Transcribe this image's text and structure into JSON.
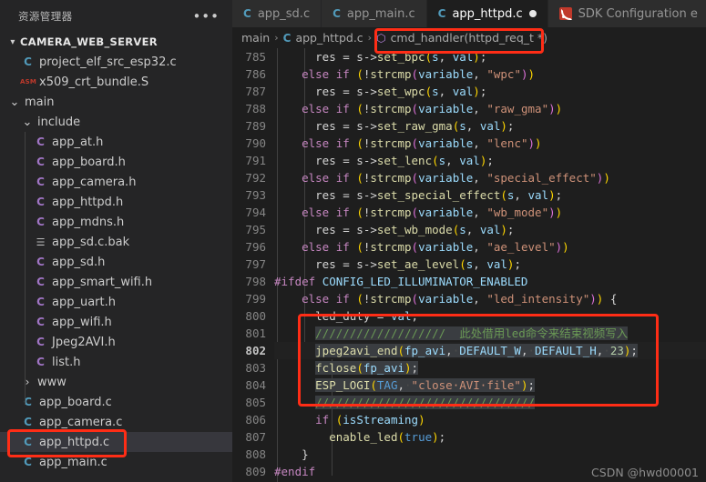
{
  "sidebar": {
    "title": "资源管理器",
    "more_label": "•••",
    "root_label": "CAMERA_WEB_SERVER",
    "items": [
      {
        "label": "project_elf_src_esp32.c",
        "icon": "c-file-icon",
        "kind": "c",
        "indent": 1,
        "type": "file"
      },
      {
        "label": "x509_crt_bundle.S",
        "icon": "asm-file-icon",
        "kind": "asm",
        "indent": 1,
        "type": "file"
      },
      {
        "label": "main",
        "icon": "chevron-down-icon",
        "kind": "folder-open",
        "indent": 0,
        "type": "folder"
      },
      {
        "label": "include",
        "icon": "chevron-down-icon",
        "kind": "folder-open",
        "indent": 1,
        "type": "folder"
      },
      {
        "label": "app_at.h",
        "icon": "h-file-icon",
        "kind": "h",
        "indent": 2,
        "type": "file"
      },
      {
        "label": "app_board.h",
        "icon": "h-file-icon",
        "kind": "h",
        "indent": 2,
        "type": "file"
      },
      {
        "label": "app_camera.h",
        "icon": "h-file-icon",
        "kind": "h",
        "indent": 2,
        "type": "file"
      },
      {
        "label": "app_httpd.h",
        "icon": "h-file-icon",
        "kind": "h",
        "indent": 2,
        "type": "file"
      },
      {
        "label": "app_mdns.h",
        "icon": "h-file-icon",
        "kind": "h",
        "indent": 2,
        "type": "file"
      },
      {
        "label": "app_sd.c.bak",
        "icon": "text-file-icon",
        "kind": "bak",
        "indent": 2,
        "type": "file"
      },
      {
        "label": "app_sd.h",
        "icon": "h-file-icon",
        "kind": "h",
        "indent": 2,
        "type": "file"
      },
      {
        "label": "app_smart_wifi.h",
        "icon": "h-file-icon",
        "kind": "h",
        "indent": 2,
        "type": "file"
      },
      {
        "label": "app_uart.h",
        "icon": "h-file-icon",
        "kind": "h",
        "indent": 2,
        "type": "file"
      },
      {
        "label": "app_wifi.h",
        "icon": "h-file-icon",
        "kind": "h",
        "indent": 2,
        "type": "file"
      },
      {
        "label": "Jpeg2AVI.h",
        "icon": "h-file-icon",
        "kind": "h",
        "indent": 2,
        "type": "file"
      },
      {
        "label": "list.h",
        "icon": "h-file-icon",
        "kind": "h",
        "indent": 2,
        "type": "file"
      },
      {
        "label": "www",
        "icon": "chevron-right-icon",
        "kind": "folder",
        "indent": 1,
        "type": "folder"
      },
      {
        "label": "app_board.c",
        "icon": "c-file-icon",
        "kind": "c",
        "indent": 1,
        "type": "file"
      },
      {
        "label": "app_camera.c",
        "icon": "c-file-icon",
        "kind": "c",
        "indent": 1,
        "type": "file"
      },
      {
        "label": "app_httpd.c",
        "icon": "c-file-icon",
        "kind": "c",
        "indent": 1,
        "type": "file",
        "selected": true,
        "highlighted": true
      },
      {
        "label": "app_main.c",
        "icon": "c-file-icon",
        "kind": "c",
        "indent": 1,
        "type": "file"
      }
    ]
  },
  "tabs": [
    {
      "label": "app_sd.c",
      "icon": "c-file-icon",
      "active": false,
      "dirty": false
    },
    {
      "label": "app_main.c",
      "icon": "c-file-icon",
      "active": false,
      "dirty": false
    },
    {
      "label": "app_httpd.c",
      "icon": "c-file-icon",
      "active": true,
      "dirty": true
    },
    {
      "label": "SDK Configuration e",
      "icon": "espressif-icon",
      "active": false,
      "dirty": false
    }
  ],
  "breadcrumb": [
    {
      "label": "main",
      "icon": ""
    },
    {
      "label": "app_httpd.c",
      "icon": "c-file-icon"
    },
    {
      "label": "cmd_handler(httpd_req_t *)",
      "icon": "symbol-method-icon",
      "highlighted": true
    }
  ],
  "editor": {
    "first_line": 785,
    "current_line": 802,
    "lines": [
      {
        "n": 785,
        "indent": 3,
        "html": "res = s-&gt;<span class=\"fn\">set_bpc</span><span class=\"pl\">(</span><span class=\"var\">s</span>, <span class=\"var\">val</span><span class=\"pl\">)</span>;"
      },
      {
        "n": 786,
        "indent": 2,
        "html": "<span class=\"k\">else if</span> <span class=\"pl\">(</span>!<span class=\"fn\">strcmp</span><span class=\"pl2\">(</span><span class=\"var\">variable</span>, <span class=\"str\">\"wpc\"</span><span class=\"pl2\">)</span><span class=\"pl\">)</span>"
      },
      {
        "n": 787,
        "indent": 3,
        "html": "res = s-&gt;<span class=\"fn\">set_wpc</span><span class=\"pl\">(</span><span class=\"var\">s</span>, <span class=\"var\">val</span><span class=\"pl\">)</span>;"
      },
      {
        "n": 788,
        "indent": 2,
        "html": "<span class=\"k\">else if</span> <span class=\"pl\">(</span>!<span class=\"fn\">strcmp</span><span class=\"pl2\">(</span><span class=\"var\">variable</span>, <span class=\"str\">\"raw_gma\"</span><span class=\"pl2\">)</span><span class=\"pl\">)</span>"
      },
      {
        "n": 789,
        "indent": 3,
        "html": "res = s-&gt;<span class=\"fn\">set_raw_gma</span><span class=\"pl\">(</span><span class=\"var\">s</span>, <span class=\"var\">val</span><span class=\"pl\">)</span>;"
      },
      {
        "n": 790,
        "indent": 2,
        "html": "<span class=\"k\">else if</span> <span class=\"pl\">(</span>!<span class=\"fn\">strcmp</span><span class=\"pl2\">(</span><span class=\"var\">variable</span>, <span class=\"str\">\"lenc\"</span><span class=\"pl2\">)</span><span class=\"pl\">)</span>"
      },
      {
        "n": 791,
        "indent": 3,
        "html": "res = s-&gt;<span class=\"fn\">set_lenc</span><span class=\"pl\">(</span><span class=\"var\">s</span>, <span class=\"var\">val</span><span class=\"pl\">)</span>;"
      },
      {
        "n": 792,
        "indent": 2,
        "html": "<span class=\"k\">else if</span> <span class=\"pl\">(</span>!<span class=\"fn\">strcmp</span><span class=\"pl2\">(</span><span class=\"var\">variable</span>, <span class=\"str\">\"special_effect\"</span><span class=\"pl2\">)</span><span class=\"pl\">)</span>"
      },
      {
        "n": 793,
        "indent": 3,
        "html": "res = s-&gt;<span class=\"fn\">set_special_effect</span><span class=\"pl\">(</span><span class=\"var\">s</span>, <span class=\"var\">val</span><span class=\"pl\">)</span>;"
      },
      {
        "n": 794,
        "indent": 2,
        "html": "<span class=\"k\">else if</span> <span class=\"pl\">(</span>!<span class=\"fn\">strcmp</span><span class=\"pl2\">(</span><span class=\"var\">variable</span>, <span class=\"str\">\"wb_mode\"</span><span class=\"pl2\">)</span><span class=\"pl\">)</span>"
      },
      {
        "n": 795,
        "indent": 3,
        "html": "res = s-&gt;<span class=\"fn\">set_wb_mode</span><span class=\"pl\">(</span><span class=\"var\">s</span>, <span class=\"var\">val</span><span class=\"pl\">)</span>;"
      },
      {
        "n": 796,
        "indent": 2,
        "html": "<span class=\"k\">else if</span> <span class=\"pl\">(</span>!<span class=\"fn\">strcmp</span><span class=\"pl2\">(</span><span class=\"var\">variable</span>, <span class=\"str\">\"ae_level\"</span><span class=\"pl2\">)</span><span class=\"pl\">)</span>"
      },
      {
        "n": 797,
        "indent": 3,
        "html": "res = s-&gt;<span class=\"fn\">set_ae_level</span><span class=\"pl\">(</span><span class=\"var\">s</span>, <span class=\"var\">val</span><span class=\"pl\">)</span>;"
      },
      {
        "n": 798,
        "indent": 0,
        "html": "<span class=\"pp\">#ifdef</span> <span class=\"var\">CONFIG_LED_ILLUMINATOR_ENABLED</span>"
      },
      {
        "n": 799,
        "indent": 2,
        "html": "<span class=\"k\">else if</span> <span class=\"pl\">(</span>!<span class=\"fn\">strcmp</span><span class=\"pl2\">(</span><span class=\"var\">variable</span>, <span class=\"str\">\"led_intensity\"</span><span class=\"pl2\">)</span><span class=\"pl\">)</span> {"
      },
      {
        "n": 800,
        "indent": 3,
        "html": "led_duty = <span class=\"var\">val</span>;"
      },
      {
        "n": 801,
        "indent": 3,
        "sel": true,
        "html": "<span class=\"cm\">///////////////////  此处借用led命令来结束视频写入</span>"
      },
      {
        "n": 802,
        "indent": 3,
        "sel": true,
        "cur": true,
        "html": "<span class=\"fn\">jpeg2avi_end</span><span class=\"pl\">(</span><span class=\"var\">fp_avi</span>,<span class=\"ws\">·</span><span class=\"var\">DEFAULT_W</span>,<span class=\"ws\">·</span><span class=\"var\">DEFAULT_H</span>,<span class=\"ws\">·</span><span class=\"num\">23</span><span class=\"pl\">)</span>;"
      },
      {
        "n": 803,
        "indent": 3,
        "sel": true,
        "html": "<span class=\"fn\">fclose</span><span class=\"pl\">(</span><span class=\"var\">fp_avi</span><span class=\"pl\">)</span>;"
      },
      {
        "n": 804,
        "indent": 3,
        "sel": true,
        "html": "<span class=\"fn\">ESP_LOGI</span><span class=\"pl\">(</span><span class=\"kb\">TAG</span>,<span class=\"ws\">·</span><span class=\"str\">\"close·AVI·file\"</span><span class=\"pl\">)</span>;"
      },
      {
        "n": 805,
        "indent": 3,
        "sel": true,
        "html": "<span class=\"cm\">////////////////////////////////</span>"
      },
      {
        "n": 806,
        "indent": 3,
        "html": "<span class=\"k\">if</span> <span class=\"pl\">(</span><span class=\"var\">isStreaming</span><span class=\"pl\">)</span>"
      },
      {
        "n": 807,
        "indent": 4,
        "html": "<span class=\"fn\">enable_led</span><span class=\"pl\">(</span><span class=\"kb\">true</span><span class=\"pl\">)</span>;"
      },
      {
        "n": 808,
        "indent": 2,
        "html": "}"
      },
      {
        "n": 809,
        "indent": 0,
        "html": "<span class=\"pp\">#endif</span>"
      }
    ]
  },
  "watermark": "CSDN @hwd00001",
  "colors": {
    "accent_red": "#ff2d16",
    "editor_bg": "#1e1e1e",
    "sidebar_bg": "#252526",
    "tab_active_bg": "#1e1e1e",
    "tab_inactive_bg": "#2d2d2d",
    "selection_bg": "#3a3d41",
    "c_icon": "#519aba",
    "h_icon": "#a074c4"
  }
}
